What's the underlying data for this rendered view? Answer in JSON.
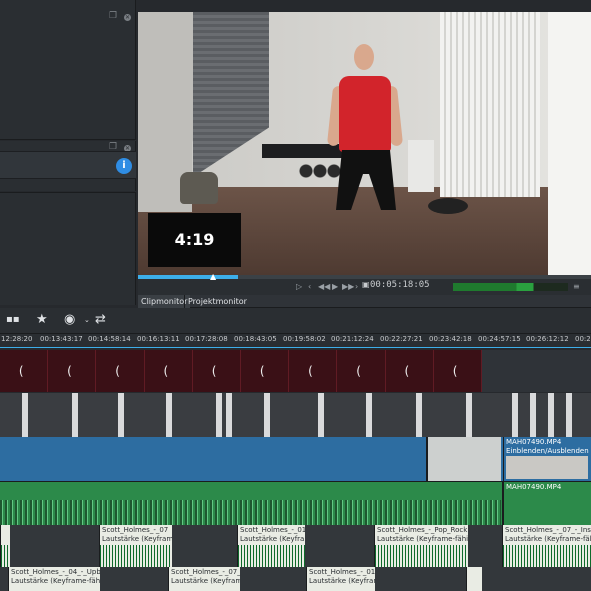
{
  "monitor": {
    "overlay_timer": "4:19",
    "timecode": "00:05:18:05",
    "tabs": [
      "Clipmonitor",
      "Projektmonitor"
    ]
  },
  "timeline": {
    "ruler": [
      "12:28:20",
      "00:13:43:17",
      "00:14:58:14",
      "00:16:13:11",
      "00:17:28:08",
      "00:18:43:05",
      "00:19:58:02",
      "00:21:12:24",
      "00:22:27:21",
      "00:23:42:18",
      "00:24:57:15",
      "00:26:12:12",
      "00:2"
    ],
    "video_clip_a": {
      "name": "MAH07490.MP4",
      "effect": "Einblenden/Ausblenden"
    },
    "audio_clip_a": {
      "name": "MAH07490.MP4"
    },
    "audio_track2": [
      {
        "name": "Scott_Holmes_-_07",
        "effect": "Lautstärke (Keyframe-fähig)"
      },
      {
        "name": "Scott_Holmes_-_01",
        "effect": "Lautstärke (Keyframe-fähig)"
      },
      {
        "name": "Scott_Holmes_-_Pop_Rock.m",
        "effect": "Lautstärke (Keyframe-fähig)"
      },
      {
        "name": "Scott_Holmes_-_07_-_Inspi",
        "effect": "Lautstärke (Keyframe-fähig)"
      }
    ],
    "audio_track3": [
      {
        "name": "Scott_Holmes_-_04_-_Upbe",
        "effect": "Lautstärke (Keyframe-fähig)"
      },
      {
        "name": "Scott_Holmes_-_07_-",
        "effect": "Lautstärke (Keyframe-fähig)"
      },
      {
        "name": "Scott_Holmes_-_01_-",
        "effect": "Lautstärke (Keyframe-fähig)"
      }
    ]
  },
  "colors": {
    "accent": "#3daee9",
    "video_track_blue": "#2d6da1",
    "audio_track_green": "#2c8a4a",
    "title_clip_red": "#3a1016",
    "info_icon": "#2f8de4"
  },
  "icons": [
    "info-icon",
    "play-icon",
    "rewind-icon",
    "forward-icon",
    "star-icon",
    "razor-icon",
    "speed-icon",
    "settings-icon"
  ]
}
